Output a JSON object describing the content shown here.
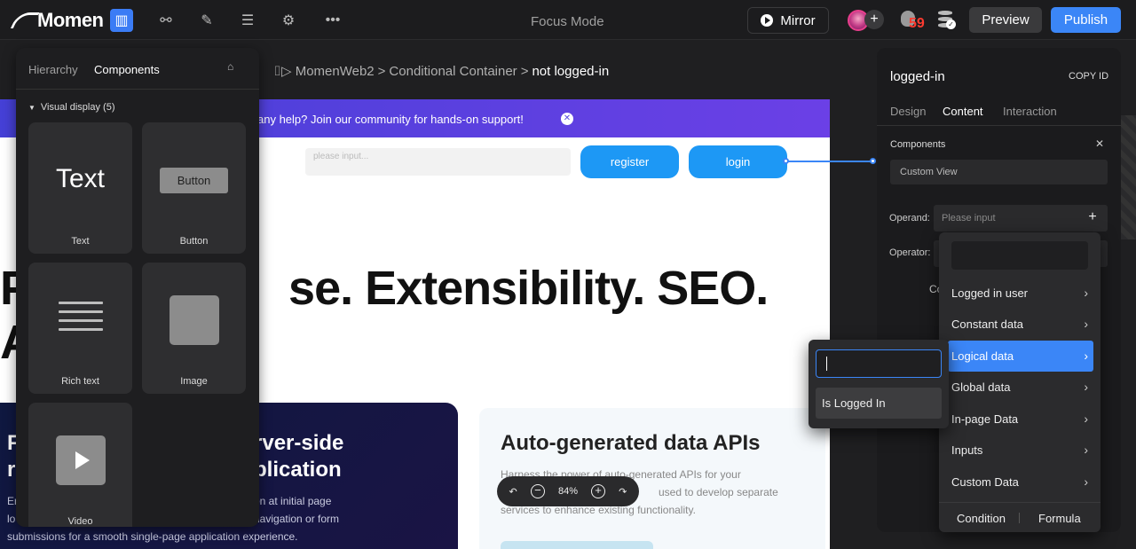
{
  "app": {
    "logo": "Momen",
    "focus_mode": "Focus Mode",
    "mirror_label": "Mirror",
    "bug_count": "59",
    "preview_label": "Preview",
    "publish_label": "Publish",
    "accent_color": "#3b86f7"
  },
  "breadcrumb": {
    "icon": "component-icon",
    "items": [
      "MomenWeb2",
      "Conditional Container",
      "not logged-in"
    ],
    "separator": ">"
  },
  "canvas": {
    "banner_text": "any help? Join our community for hands-on support!",
    "input_placeholder": "please input...",
    "register_label": "register",
    "login_label": "login",
    "hero_line1": "se. Extensibility. SEO.",
    "hero_line1_left": "P",
    "hero_line2": "A",
    "dark_card": {
      "title_l1": "F",
      "title_l2": "r",
      "title_r1": "rver-side",
      "title_r2": "plication",
      "body_l1": "Er",
      "body_l2": "lo",
      "body_r1": "on at initial page",
      "body_r2": "navigation or form",
      "body_last": "submissions for a smooth single-page application experience."
    },
    "light_card": {
      "title": "Auto-generated data APIs",
      "body_1": "Harness the power of auto-generated APIs for your",
      "body_2": "used to develop separate",
      "body_3": "services to enhance existing functionality."
    }
  },
  "zoom": {
    "level": "84%",
    "undo": "↶",
    "redo": "↷",
    "minus": "−",
    "plus": "+"
  },
  "left_panel": {
    "tabs": [
      "Hierarchy",
      "Components"
    ],
    "active_tab": "Components",
    "section_label": "Visual display (5)",
    "components": [
      {
        "label": "Text",
        "preview": "Text"
      },
      {
        "label": "Button",
        "preview": "Button"
      },
      {
        "label": "Rich text"
      },
      {
        "label": "Image"
      },
      {
        "label": "Video"
      }
    ]
  },
  "right_panel": {
    "title": "logged-in",
    "copy_id": "COPY ID",
    "tabs": [
      "Design",
      "Content",
      "Interaction"
    ],
    "active_tab": "Content",
    "components_label": "Components",
    "custom_view": "Custom View",
    "operand_label": "Operand:",
    "operand_placeholder": "Please input",
    "operator_label": "Operator:",
    "co_label": "Co"
  },
  "dropdown": {
    "items": [
      {
        "label": "Logged in user"
      },
      {
        "label": "Constant data"
      },
      {
        "label": "Logical data",
        "active": true
      },
      {
        "label": "Global data"
      },
      {
        "label": "In-page Data"
      },
      {
        "label": "Inputs"
      },
      {
        "label": "Custom Data"
      }
    ],
    "footer_left": "Condition",
    "footer_right": "Formula"
  },
  "submenu": {
    "item": "Is Logged In"
  }
}
